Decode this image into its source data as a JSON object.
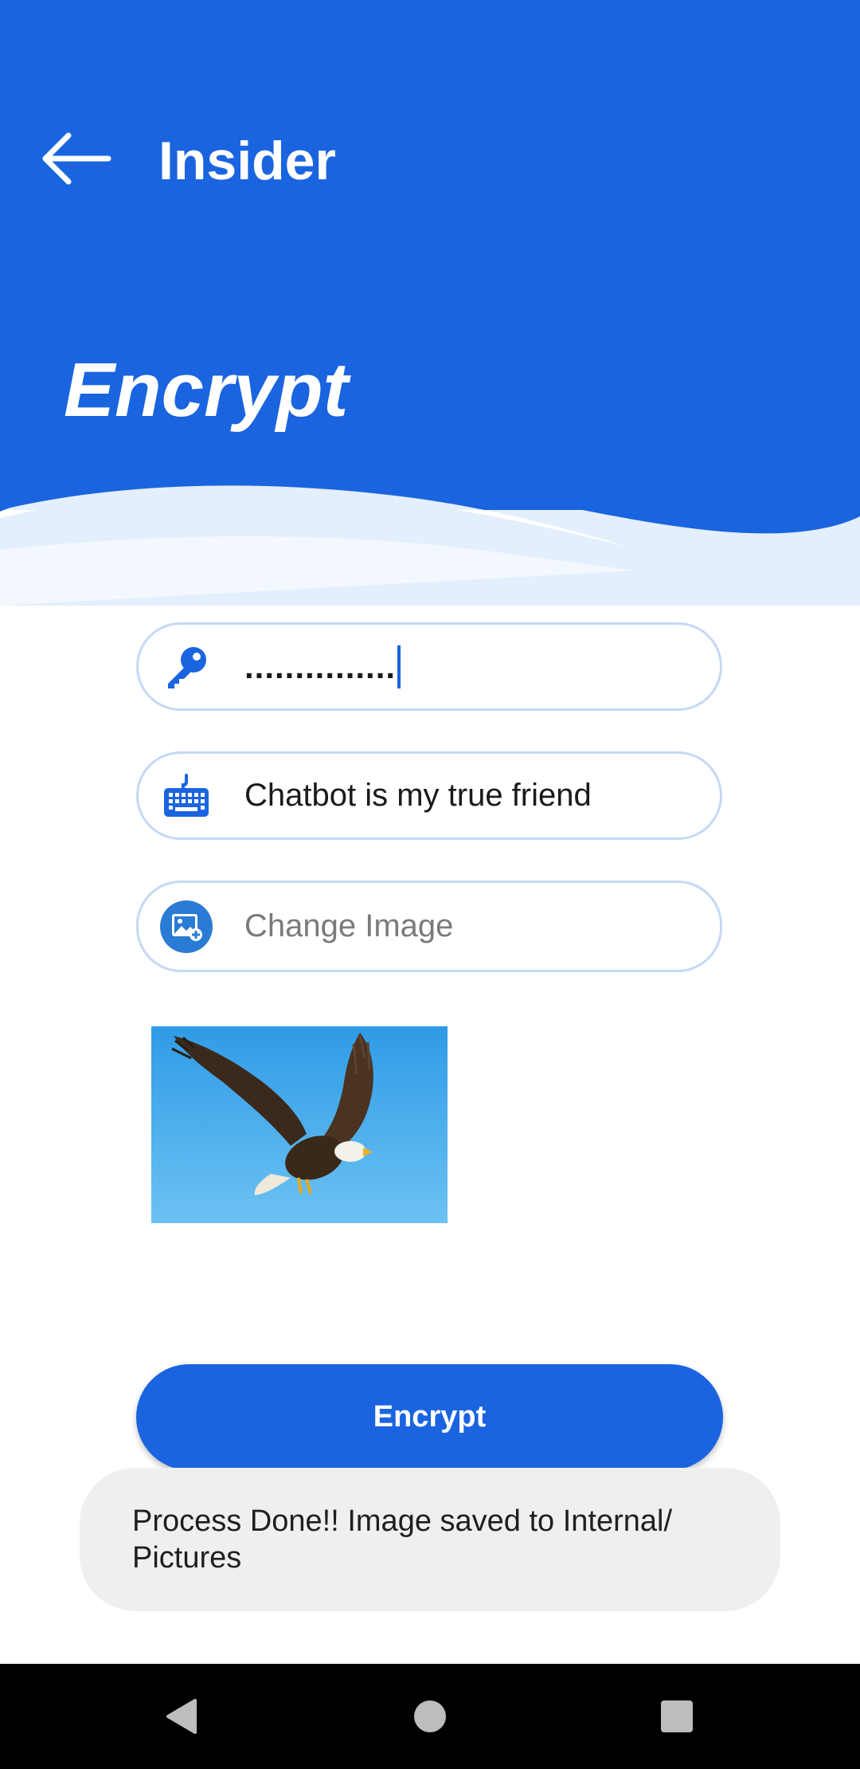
{
  "header": {
    "app_title": "Insider",
    "page_heading": "Encrypt",
    "back_icon": "arrow-left-icon"
  },
  "form": {
    "password": {
      "icon": "key-icon",
      "value": "..............."
    },
    "message": {
      "icon": "keyboard-icon",
      "value": "Chatbot is my true friend"
    },
    "image": {
      "icon": "add-image-icon",
      "placeholder": "Change Image"
    },
    "preview": {
      "alt": "bald eagle in flight"
    }
  },
  "encrypt_button": {
    "label": "Encrypt"
  },
  "toast": {
    "message": "Process Done!! Image saved to Internal/ Pictures"
  },
  "navbar": {
    "back_icon": "triangle-back-icon",
    "home_icon": "circle-home-icon",
    "recents_icon": "square-recents-icon"
  },
  "colors": {
    "primary": "#1a64e0",
    "field_border": "#c5d8f5",
    "toast_bg": "#efefef",
    "wave_light": "#e3effc"
  }
}
